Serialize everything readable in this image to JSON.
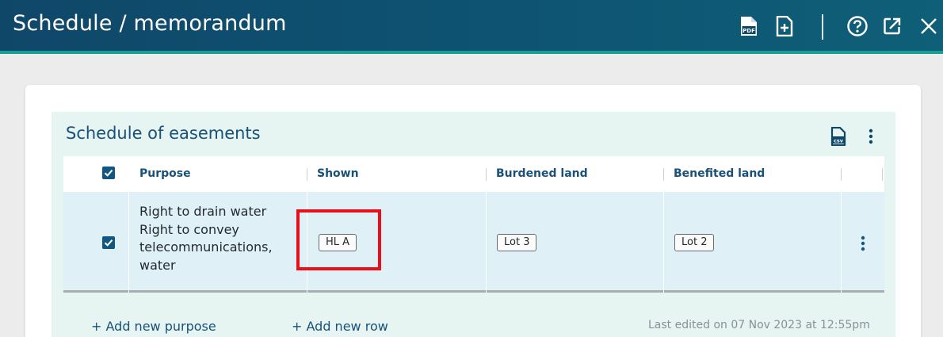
{
  "header": {
    "title": "Schedule / memorandum",
    "icons": [
      "pdf-icon",
      "add-document-icon",
      "help-icon",
      "open-external-icon",
      "close-icon"
    ],
    "pdf_label": "PDF",
    "bg_color": "#0f4769",
    "accent_color": "#1a9e98"
  },
  "panel": {
    "title": "Schedule of easements",
    "csv_label": "csv",
    "bg_color": "#e6f4f2"
  },
  "table": {
    "columns": [
      "Purpose",
      "Shown",
      "Burdened land",
      "Benefited land"
    ],
    "header_checked": true,
    "rows": [
      {
        "checked": true,
        "purpose_lines": [
          "Right to drain water",
          "Right to convey",
          "telecommunications,",
          "water"
        ],
        "shown": "HL A",
        "burdened": "Lot 3",
        "benefited": "Lot 2"
      }
    ]
  },
  "footer": {
    "add_purpose": "+ Add new purpose",
    "add_row": "+ Add new row",
    "last_edited": "Last edited on 07 Nov 2023 at 12:55pm"
  },
  "highlight_color": "#e8111a"
}
